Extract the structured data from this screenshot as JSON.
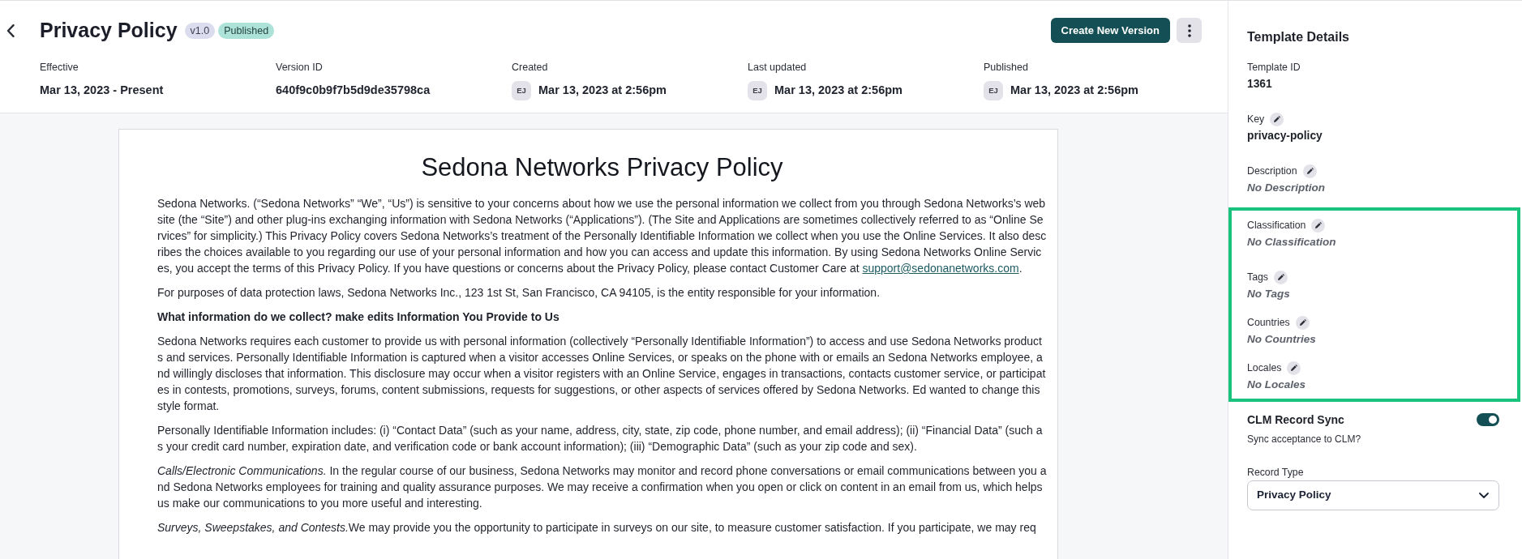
{
  "header": {
    "title": "Privacy Policy",
    "badges": [
      {
        "text": "v1.0",
        "kind": "version"
      },
      {
        "text": "Published",
        "kind": "status"
      }
    ],
    "primary_action": "Create New Version",
    "meta": [
      {
        "label": "Effective",
        "value": "Mar 13, 2023 - Present"
      },
      {
        "label": "Version ID",
        "value": "640f9c0b9f7b5d9de35798ca"
      },
      {
        "label": "Created",
        "avatar": "EJ",
        "value": "Mar 13, 2023 at 2:56pm"
      },
      {
        "label": "Last updated",
        "avatar": "EJ",
        "value": "Mar 13, 2023 at 2:56pm"
      },
      {
        "label": "Published",
        "avatar": "EJ",
        "value": "Mar 13, 2023 at 2:56pm"
      }
    ]
  },
  "document": {
    "title": "Sedona Networks Privacy Policy",
    "paragraphs": [
      {
        "kind": "text",
        "text": "Sedona Networks. (“Sedona Networks” “We”, “Us”) is sensitive to your concerns about how we use the personal information we collect from you through Sedona Networks’s website (the “Site”) and other plug-ins exchanging information with Sedona Networks (“Applications”). (The Site and Applications are sometimes collectively referred to as “Online Services” for simplicity.) This Privacy Policy covers Sedona Networks’s treatment of the Personally Identifiable Information we collect when you use the Online Services. It also describes the choices available to you regarding our use of your personal information and how you can access and update this information. By using Sedona Networks Online Services, you accept the terms of this Privacy Policy. If you have questions or concerns about the Privacy Policy, please contact Customer Care at ",
        "link": "support@sedonanetworks.com",
        "after": "."
      },
      {
        "kind": "text",
        "text": "For purposes of data protection laws, Sedona Networks Inc., 123 1st St, San Francisco, CA 94105, is the entity responsible for your information."
      },
      {
        "kind": "heading",
        "text": "What information do we collect? make edits Information You Provide to Us"
      },
      {
        "kind": "text",
        "text": "Sedona Networks requires each customer to provide us with personal information (collectively “Personally Identifiable Information”) to access and use Sedona Networks products and services. Personally Identifiable Information is captured when a visitor accesses Online Services, or speaks on the phone with or emails an Sedona Networks employee, and willingly discloses that information. This disclosure may occur when a visitor registers with an Online Service, engages in transactions, contacts customer service, or participates in contests, promotions, surveys, forums, content submissions, requests for suggestions, or other aspects of services offered by Sedona Networks. Ed wanted to change this style format."
      },
      {
        "kind": "text",
        "text": "Personally Identifiable Information includes: (i) “Contact Data” (such as your name, address, city, state, zip code, phone number, and email address); (ii) “Financial Data” (such as your credit card number, expiration date, and verification code or bank account information); (iii) “Demographic Data” (such as your zip code and sex)."
      },
      {
        "kind": "text",
        "text": "*Calls/Electronic Communications.* In the regular course of our business, Sedona Networks may monitor and record phone conversations or email communications between you and Sedona Networks employees for training and quality assurance purposes. We may receive a confirmation when you open or click on content in an email from us, which helps us make our communications to you more useful and interesting."
      },
      {
        "kind": "text",
        "lead": "Surveys, Sweepstakes, and Contests.",
        "text": "We may provide you the opportunity to participate in surveys on our site, to measure customer satisfaction. If you participate, we may req"
      }
    ]
  },
  "sidebar": {
    "title": "Template Details",
    "fields": [
      {
        "label": "Template ID",
        "value": "1361",
        "editable": false,
        "empty": false,
        "highlighted": false
      },
      {
        "label": "Key",
        "value": "privacy-policy",
        "editable": true,
        "empty": false,
        "highlighted": false
      },
      {
        "label": "Description",
        "value": "No Description",
        "editable": true,
        "empty": true,
        "highlighted": false
      },
      {
        "label": "Classification",
        "value": "No Classification",
        "editable": true,
        "empty": true,
        "highlighted": true
      },
      {
        "label": "Tags",
        "value": "No Tags",
        "editable": true,
        "empty": true,
        "highlighted": true
      },
      {
        "label": "Countries",
        "value": "No Countries",
        "editable": true,
        "empty": true,
        "highlighted": true
      },
      {
        "label": "Locales",
        "value": "No Locales",
        "editable": true,
        "empty": true,
        "highlighted": true
      }
    ],
    "sync": {
      "label": "CLM Record Sync",
      "on": true,
      "description": "Sync acceptance to CLM?"
    },
    "record_type": {
      "label": "Record Type",
      "value": "Privacy Policy"
    }
  }
}
